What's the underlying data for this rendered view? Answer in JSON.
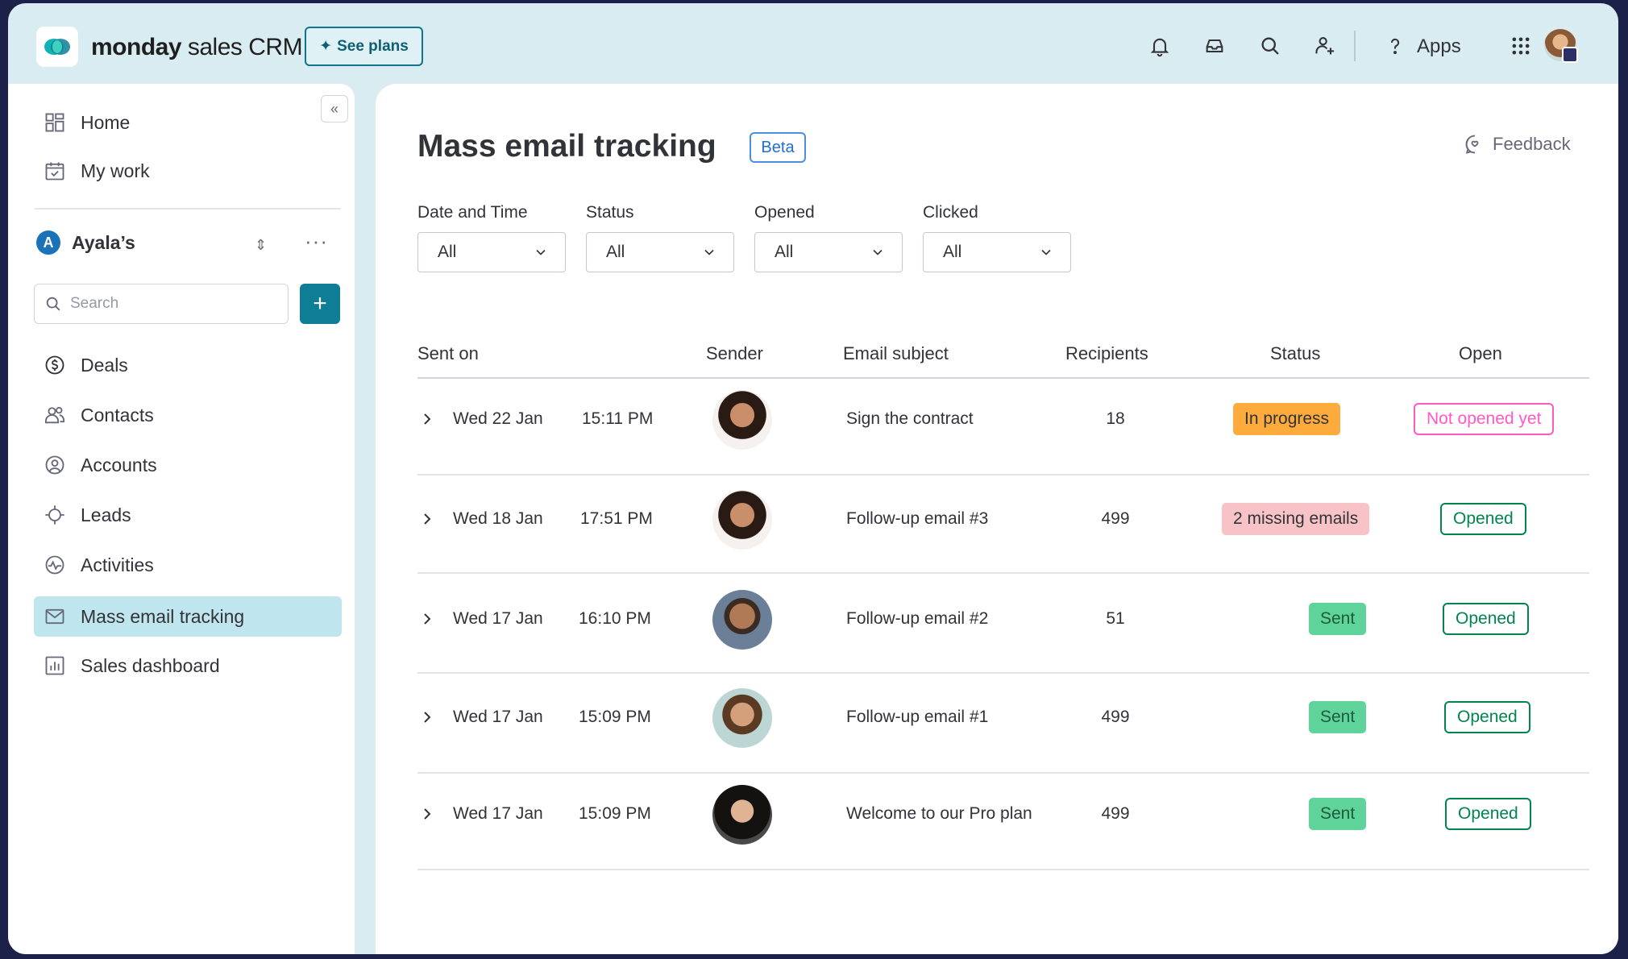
{
  "topbar": {
    "brand_bold": "monday",
    "brand_rest": " sales CRM",
    "see_plans": "See plans",
    "apps": "Apps",
    "icons": [
      "bell-icon",
      "inbox-icon",
      "search-icon",
      "invite-user-icon",
      "help-icon",
      "apps-grid-icon"
    ]
  },
  "sidebar": {
    "nav": [
      {
        "label": "Home",
        "icon": "home-icon"
      },
      {
        "label": "My work",
        "icon": "calendar-check-icon"
      }
    ],
    "workspace": {
      "initial": "A",
      "name": "Ayala’s"
    },
    "search": {
      "placeholder": "Search"
    },
    "add_label": "+",
    "items": [
      {
        "label": "Deals",
        "icon": "dollar-icon"
      },
      {
        "label": "Contacts",
        "icon": "contacts-icon"
      },
      {
        "label": "Accounts",
        "icon": "accounts-icon"
      },
      {
        "label": "Leads",
        "icon": "crosshair-icon"
      },
      {
        "label": "Activities",
        "icon": "activity-icon"
      },
      {
        "label": "Mass email tracking",
        "icon": "mail-icon",
        "active": true
      },
      {
        "label": "Sales dashboard",
        "icon": "chart-icon"
      }
    ]
  },
  "main": {
    "title": "Mass email tracking",
    "beta": "Beta",
    "feedback": "Feedback",
    "filters": [
      {
        "label": "Date and Time",
        "value": "All"
      },
      {
        "label": "Status",
        "value": "All"
      },
      {
        "label": "Opened",
        "value": "All"
      },
      {
        "label": "Clicked",
        "value": "All"
      }
    ],
    "columns": {
      "sent_on": "Sent on",
      "sender": "Sender",
      "subject": "Email subject",
      "recipients": "Recipients",
      "status": "Status",
      "open": "Open"
    },
    "rows": [
      {
        "date": "Wed 22 Jan",
        "time": "15:11 PM",
        "subject": "Sign the contract",
        "recipients": "18",
        "status": "In progress",
        "open": "Not opened yet"
      },
      {
        "date": "Wed 18 Jan",
        "time": "17:51 PM",
        "subject": "Follow-up email #3",
        "recipients": "499",
        "status": "2 missing emails",
        "open": "Opened"
      },
      {
        "date": "Wed 17 Jan",
        "time": "16:10 PM",
        "subject": "Follow-up email #2",
        "recipients": "51",
        "status": "Sent",
        "open": "Opened"
      },
      {
        "date": "Wed 17 Jan",
        "time": "15:09 PM",
        "subject": "Follow-up email #1",
        "recipients": "499",
        "status": "Sent",
        "open": "Opened"
      },
      {
        "date": "Wed 17 Jan",
        "time": "15:09 PM",
        "subject": "Welcome to our Pro plan",
        "recipients": "499",
        "status": "Sent",
        "open": "Opened"
      }
    ]
  },
  "colors": {
    "accent": "#0e7d96",
    "in_progress": "#fdab3d",
    "missing": "#f8c3c7",
    "sent": "#5ed39a",
    "not_opened": "#ff5ac4",
    "opened": "#00854d"
  }
}
